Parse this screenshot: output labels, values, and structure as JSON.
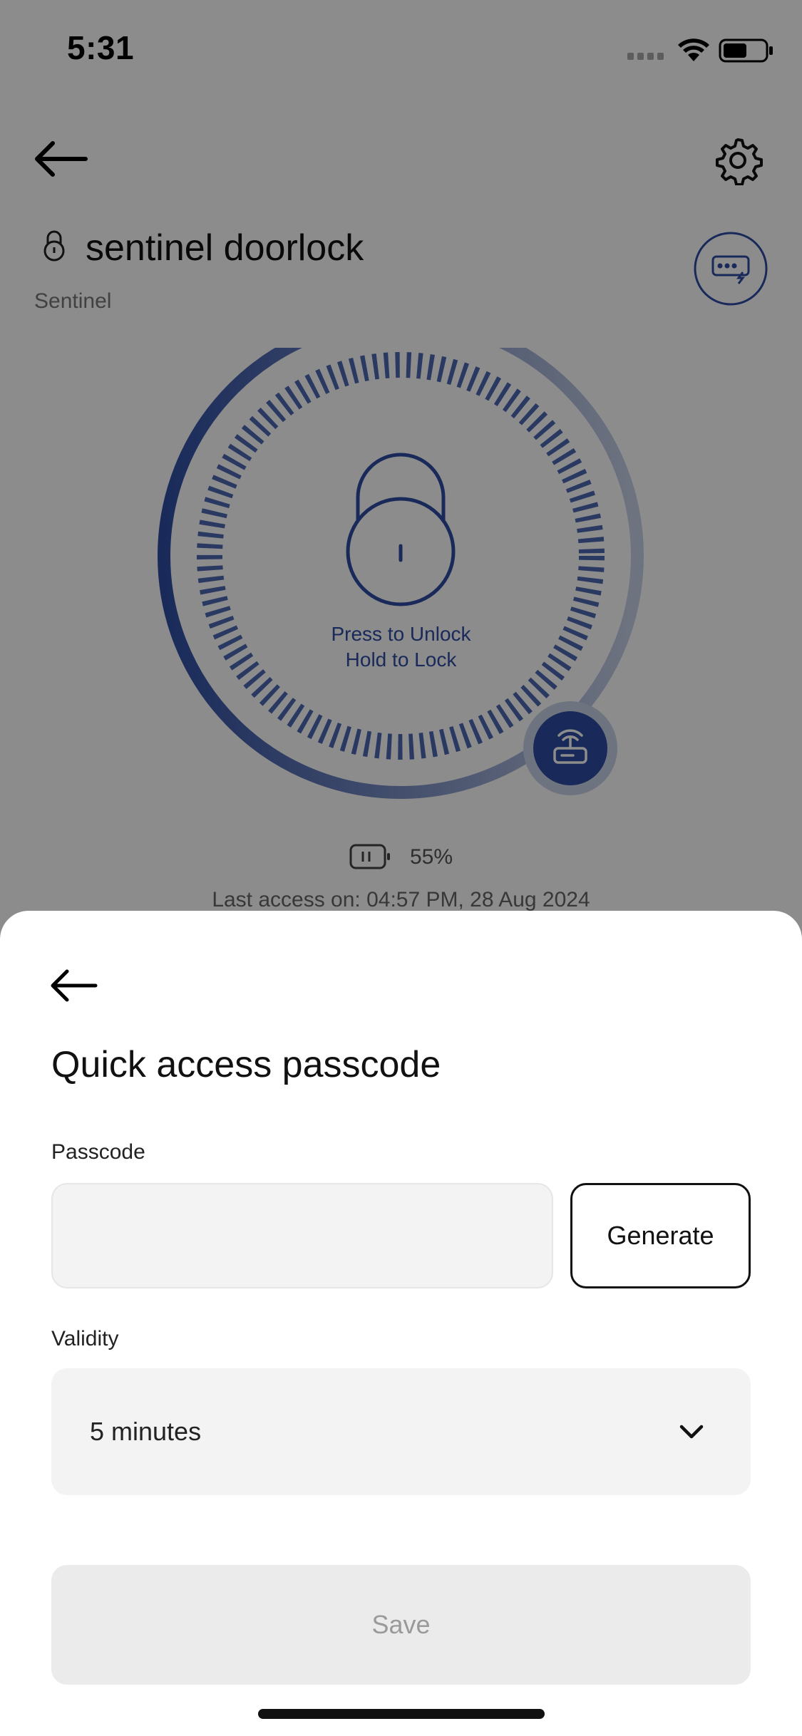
{
  "status_bar": {
    "time": "5:31"
  },
  "device": {
    "name": "sentinel doorlock",
    "brand": "Sentinel",
    "dial_hint_line1": "Press to Unlock",
    "dial_hint_line2": "Hold to Lock",
    "battery_percent": "55%",
    "last_access": "Last access on: 04:57 PM, 28 Aug 2024"
  },
  "sheet": {
    "title": "Quick access passcode",
    "passcode_label": "Passcode",
    "passcode_value": "",
    "generate_label": "Generate",
    "validity_label": "Validity",
    "validity_value": "5 minutes",
    "save_label": "Save"
  },
  "colors": {
    "accent": "#2f4ea5",
    "dial_light": "#c9d3e8"
  },
  "icons": [
    "back-arrow-icon",
    "gear-icon",
    "lock-icon",
    "keypad-icon",
    "padlock-icon",
    "gateway-icon",
    "battery-icon",
    "chevron-down-icon"
  ]
}
